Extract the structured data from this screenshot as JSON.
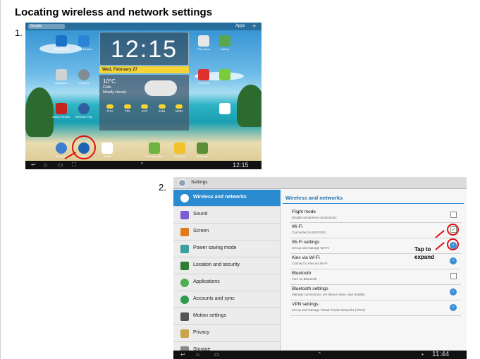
{
  "document": {
    "title": "Locating wireless and network settings",
    "step1": "1.",
    "step2": "2."
  },
  "home_screen": {
    "search_hint": "Google",
    "apps_label": "Apps",
    "clock_time": "12:15",
    "date": "Wed, February 27",
    "weather": {
      "temp": "10°C",
      "city": "Cork",
      "condition": "Mostly cloudy",
      "days": [
        "THU",
        "FRI",
        "SAT",
        "SUN",
        "MON"
      ]
    },
    "apps": [
      {
        "label": "TeamViewer",
        "color": "#1a73c9"
      },
      {
        "label": "TV Quickstart",
        "color": "#2a84d8"
      },
      {
        "label": "Play Store",
        "color": "#e8e8e8"
      },
      {
        "label": "Gallery",
        "color": "#5aa64a"
      },
      {
        "label": "Calculator",
        "color": "#cfd3d6"
      },
      {
        "label": "Camera",
        "color": "#7f8c96"
      },
      {
        "label": "YouTube",
        "color": "#e23030"
      },
      {
        "label": "",
        "color": "#7acb3a"
      },
      {
        "label": "Adobe Reader",
        "color": "#c4241e"
      },
      {
        "label": "AllShare Play",
        "color": "#2f5f9c"
      },
      {
        "label": "",
        "color": "#ffffff"
      },
      {
        "label": "Browser",
        "color": "#3b7fd0"
      },
      {
        "label": "Settings",
        "color": "#1d62b5"
      },
      {
        "label": "Email",
        "color": "#ffffff"
      },
      {
        "label": "Evernote Web",
        "color": "#6db33f"
      },
      {
        "label": "My Files",
        "color": "#f2c12e"
      },
      {
        "label": "Evernote",
        "color": "#5a8f3a"
      }
    ],
    "status_time": "12:15"
  },
  "settings_screen": {
    "app_title": "Settings",
    "left_items": [
      {
        "label": "Wireless and networks",
        "icon_color": "#ffffff"
      },
      {
        "label": "Sound",
        "icon_color": "#7b5bd6"
      },
      {
        "label": "Screen",
        "icon_color": "#e07a1a"
      },
      {
        "label": "Power saving mode",
        "icon_color": "#3aa0a0"
      },
      {
        "label": "Location and security",
        "icon_color": "#2e7d32"
      },
      {
        "label": "Applications",
        "icon_color": "#4caf50"
      },
      {
        "label": "Accounts and sync",
        "icon_color": "#2e9b4e"
      },
      {
        "label": "Motion settings",
        "icon_color": "#555555"
      },
      {
        "label": "Privacy",
        "icon_color": "#c9a24a"
      },
      {
        "label": "Storage",
        "icon_color": "#888888"
      }
    ],
    "panel_title": "Wireless and networks",
    "rows": [
      {
        "title": "Flight mode",
        "subtitle": "Disable all wireless connections",
        "control": "checkbox",
        "checked": false
      },
      {
        "title": "Wi-Fi",
        "subtitle": "Connected to WSPGW1",
        "control": "checkbox",
        "checked": true
      },
      {
        "title": "Wi-Fi settings",
        "subtitle": "Set up and manage WAPs",
        "control": "arrow"
      },
      {
        "title": "Kies via Wi-Fi",
        "subtitle": "Connect to Kies via Wi-Fi",
        "control": "arrow"
      },
      {
        "title": "Bluetooth",
        "subtitle": "Turn on Bluetooth",
        "control": "checkbox",
        "checked": false
      },
      {
        "title": "Bluetooth settings",
        "subtitle": "Manage connections, set device name, and visibility",
        "control": "arrow"
      },
      {
        "title": "VPN settings",
        "subtitle": "Set up and manage Virtual Private Networks (VPNs)",
        "control": "arrow"
      }
    ],
    "annotation": "Tap to expand",
    "status_time": "11:44"
  }
}
